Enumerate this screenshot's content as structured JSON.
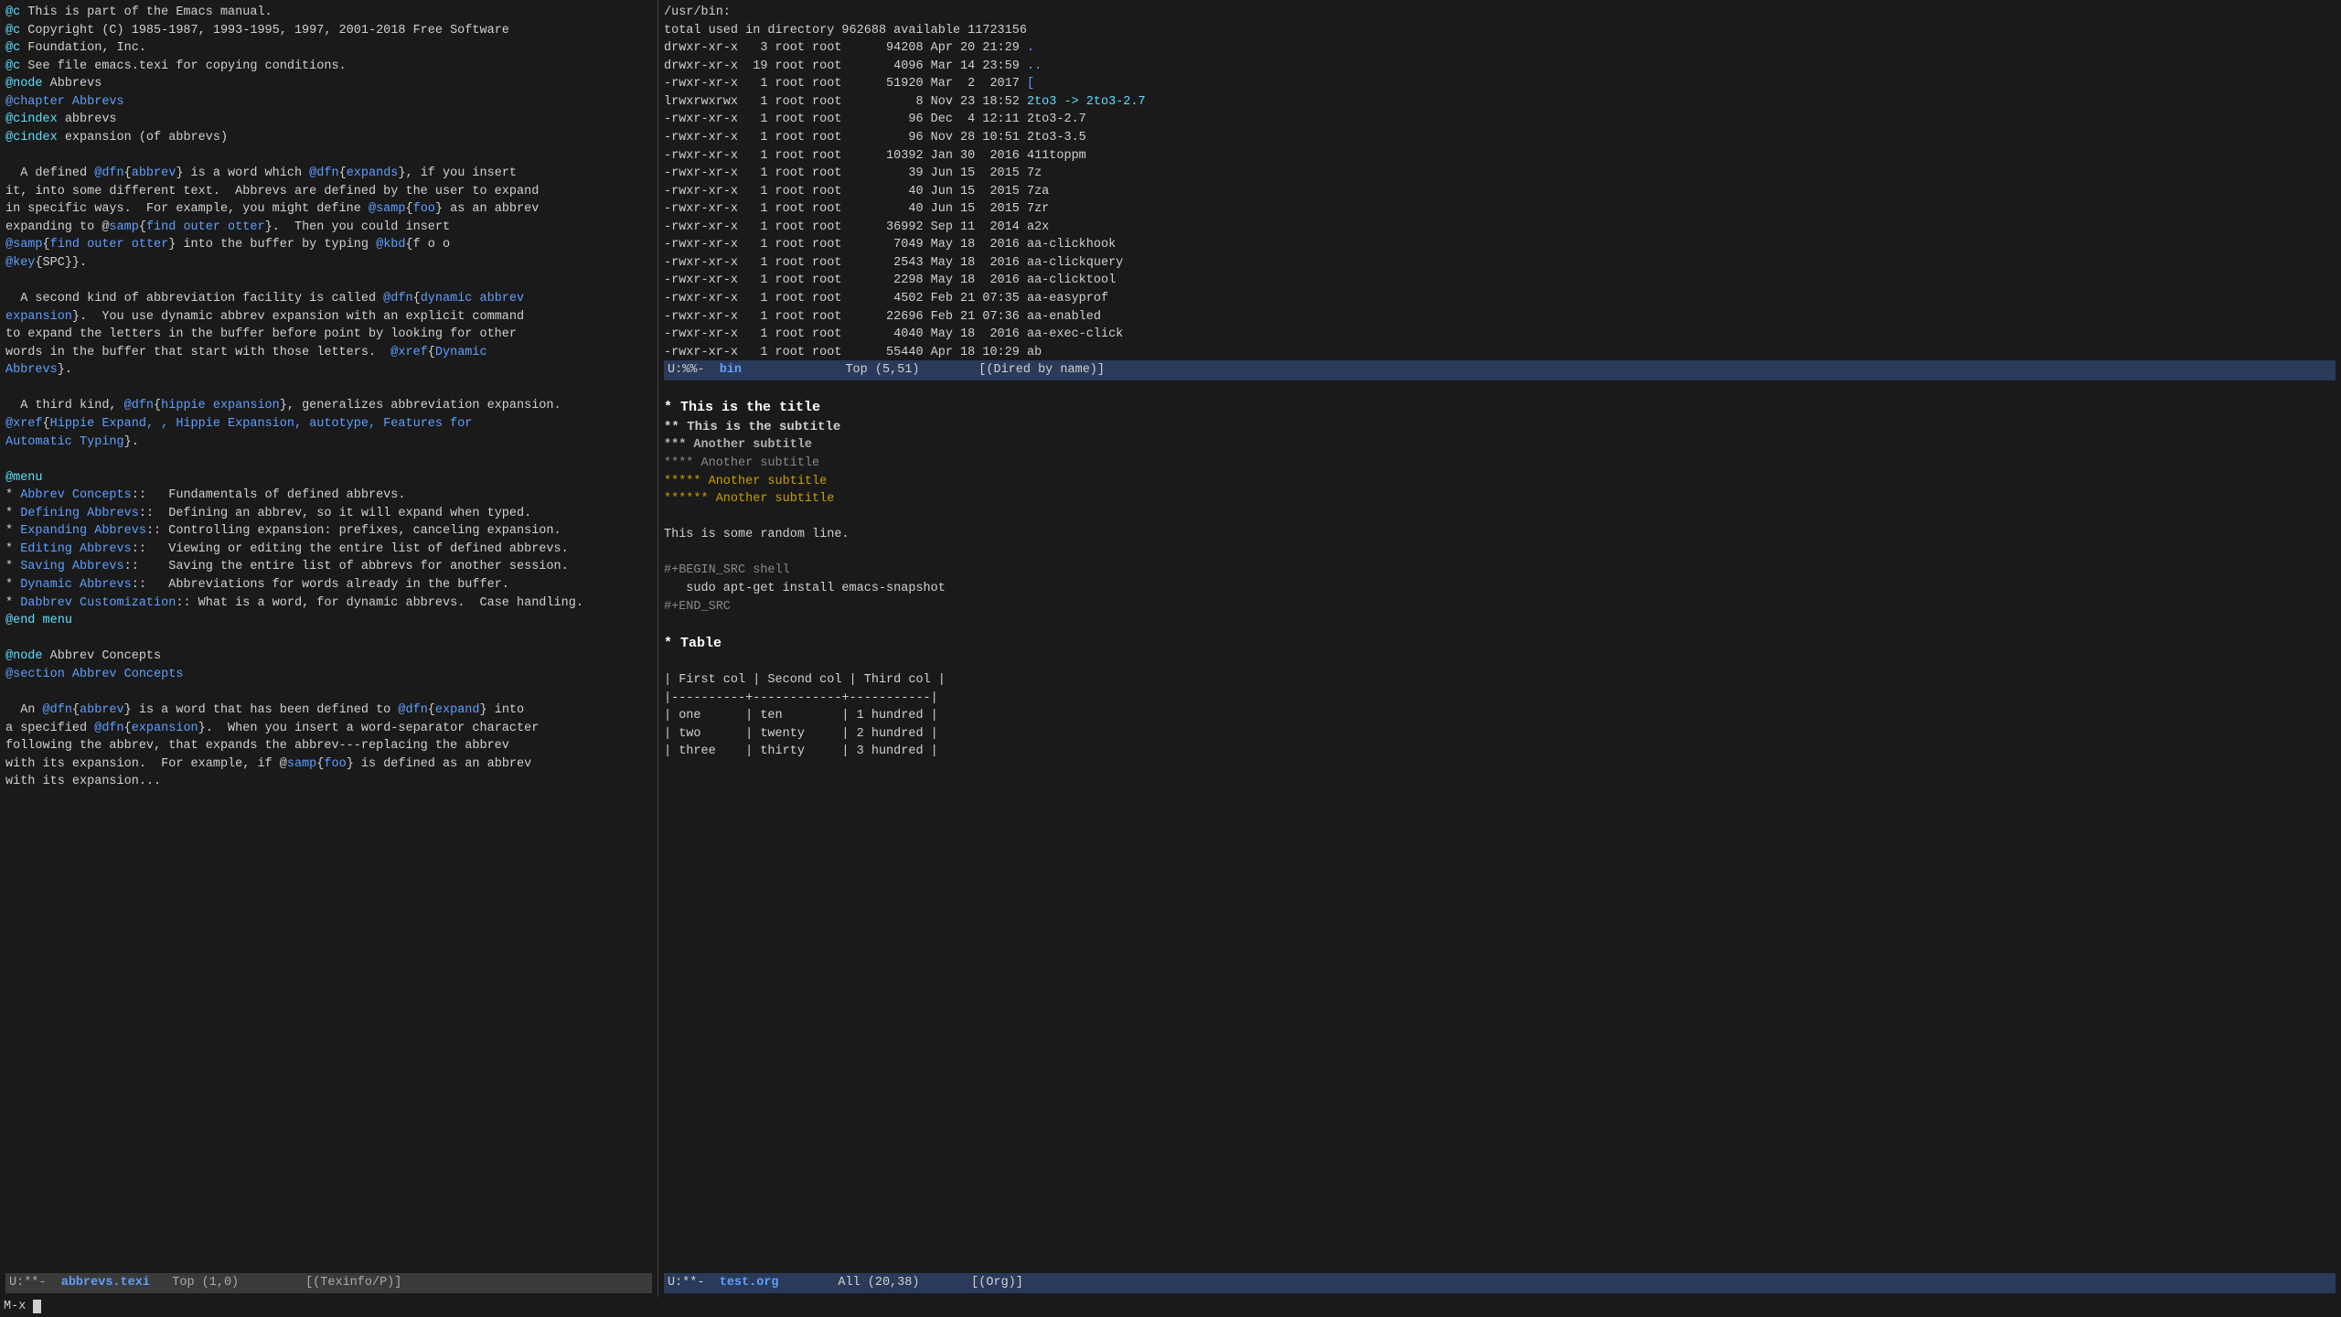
{
  "left_pane": {
    "content": "left_texinfo",
    "mode_line": "U:**-  abbrevs.texi   Top (1,0)         [(Texinfo/P)]"
  },
  "right_pane_top": {
    "content": "right_dired",
    "mode_line": "U:%%- bin              Top (5,51)        [(Dired by name)]"
  },
  "right_pane_bottom": {
    "content": "right_org",
    "mode_line": "U:**-  test.org        All (20,38)       [(Org)]"
  },
  "echo_area": "M-x ",
  "colors": {
    "cyan": "#5fdfff",
    "blue": "#5f9fff",
    "orange": "#c8a000",
    "white": "#ffffff",
    "gray": "#888888",
    "modeline_active_bg": "#2a3a5a",
    "modeline_inactive_bg": "#3a3a3a"
  }
}
